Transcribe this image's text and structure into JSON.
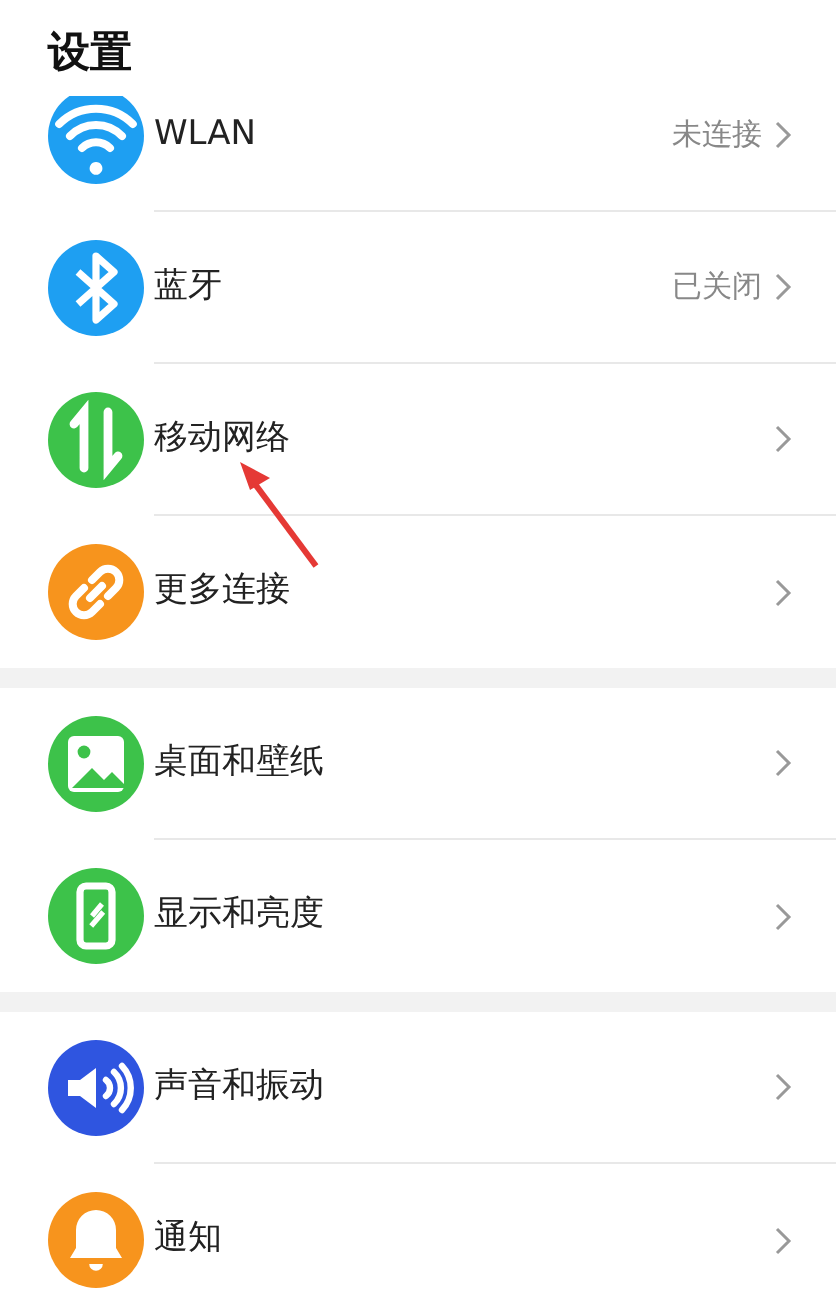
{
  "title": "设置",
  "sections": [
    {
      "items": [
        {
          "kind": "wifi",
          "label": "WLAN",
          "value": "未连接"
        },
        {
          "kind": "bluetooth",
          "label": "蓝牙",
          "value": "已关闭"
        },
        {
          "kind": "mobile-data",
          "label": "移动网络"
        },
        {
          "kind": "link",
          "label": "更多连接"
        }
      ]
    },
    {
      "items": [
        {
          "kind": "image",
          "label": "桌面和壁纸"
        },
        {
          "kind": "phone",
          "label": "显示和亮度"
        }
      ]
    },
    {
      "items": [
        {
          "kind": "sound",
          "label": "声音和振动"
        },
        {
          "kind": "bell",
          "label": "通知"
        }
      ]
    }
  ]
}
